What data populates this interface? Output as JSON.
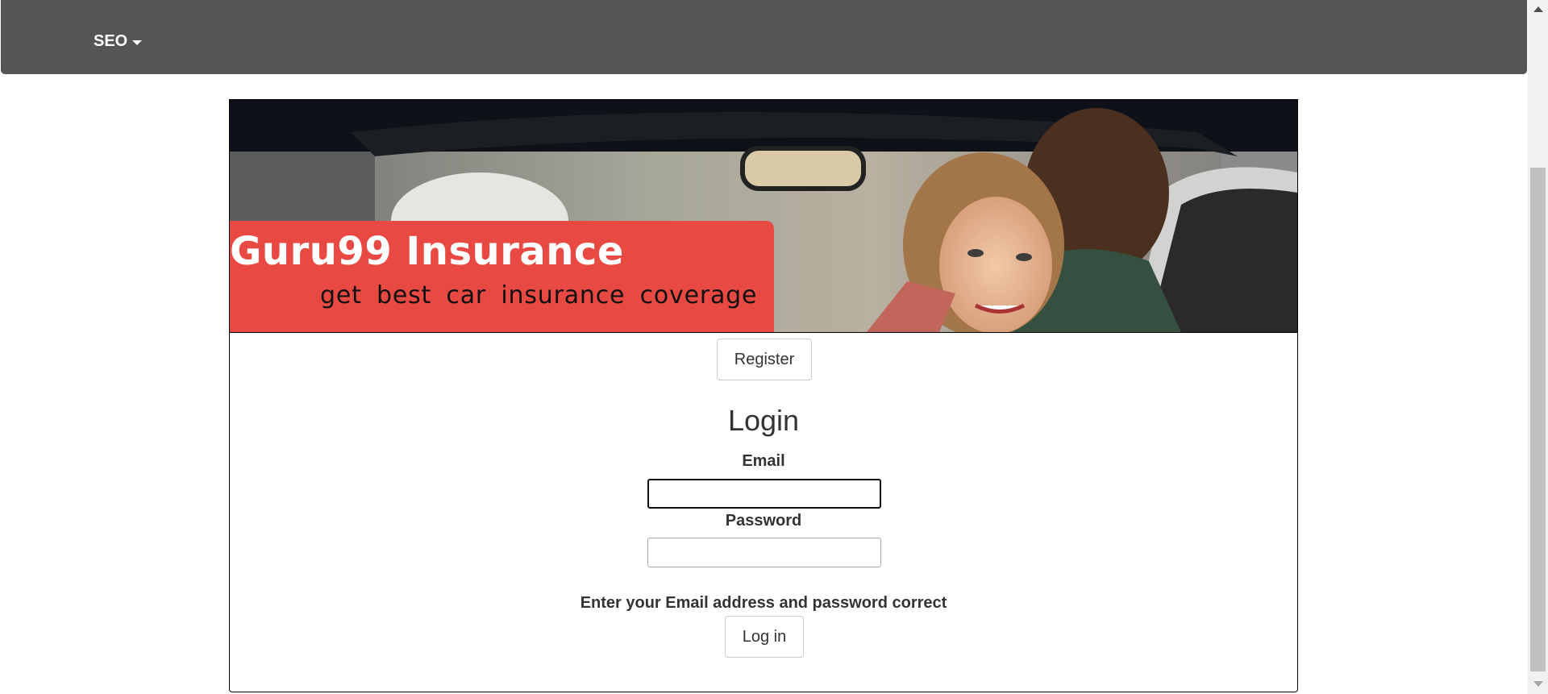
{
  "navbar": {
    "dropdown_label": "SEO"
  },
  "banner": {
    "title": "Guru99 Insurance",
    "subtitle": "get best car insurance coverage"
  },
  "register": {
    "label": "Register"
  },
  "login": {
    "heading": "Login",
    "email_label": "Email",
    "email_value": "",
    "password_label": "Password",
    "password_value": "",
    "hint": "Enter your Email address and password correct",
    "submit_label": "Log in"
  },
  "colors": {
    "navbar_bg": "#555555",
    "banner_red": "#e84a43",
    "text": "#333333"
  },
  "icons": {
    "dropdown": "caret-down-icon",
    "scroll_up": "scroll-up-arrow-icon",
    "scroll_down": "scroll-down-arrow-icon"
  }
}
